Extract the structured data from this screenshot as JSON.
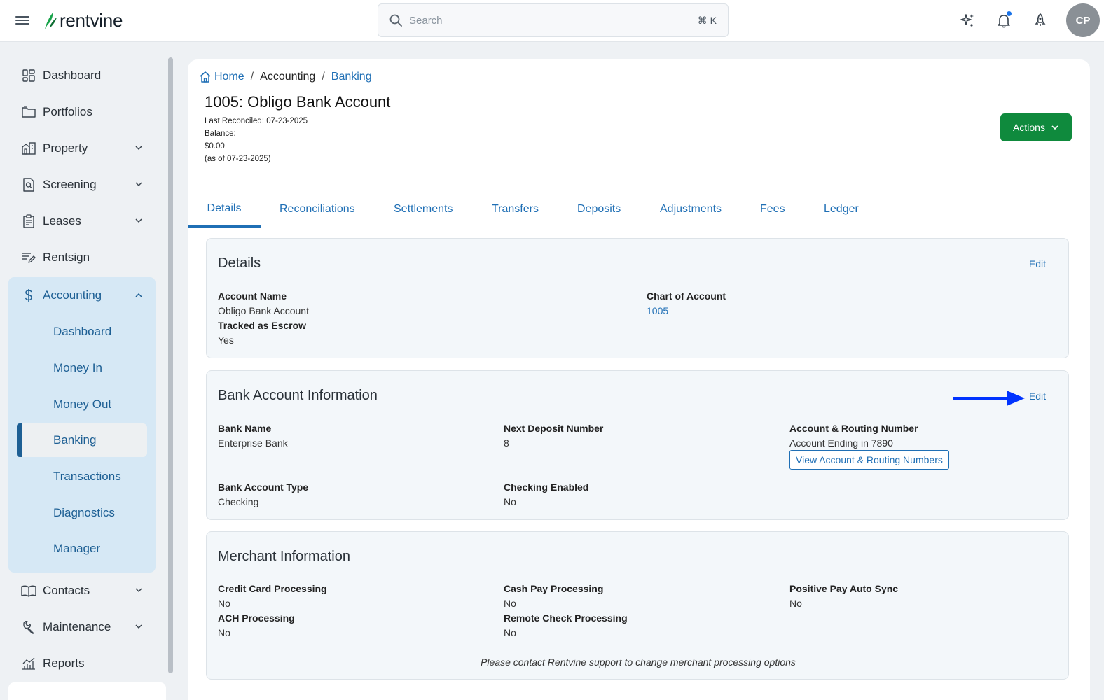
{
  "app": {
    "brand": "rentvine"
  },
  "search": {
    "placeholder": "Search",
    "shortcut": "⌘ K"
  },
  "user": {
    "initials": "CP"
  },
  "colors": {
    "brand_green": "#0f8a3d",
    "link_blue": "#1f6fb5",
    "accounting_bg": "#d6e8f5",
    "arrow_blue": "#0033ff"
  },
  "sidebar": {
    "items_top": [
      {
        "label": "Dashboard",
        "icon": "dashboard-icon"
      },
      {
        "label": "Portfolios",
        "icon": "folder-icon"
      },
      {
        "label": "Property",
        "icon": "building-icon"
      },
      {
        "label": "Screening",
        "icon": "screening-icon"
      },
      {
        "label": "Leases",
        "icon": "clipboard-icon"
      },
      {
        "label": "Rentsign",
        "icon": "sign-icon"
      }
    ],
    "accounting": {
      "label": "Accounting",
      "icon": "dollar-icon",
      "sub": [
        "Dashboard",
        "Money In",
        "Money Out",
        "Banking",
        "Transactions",
        "Diagnostics",
        "Manager"
      ],
      "active": "Banking"
    },
    "items_bottom": [
      {
        "label": "Contacts",
        "icon": "book-icon"
      },
      {
        "label": "Maintenance",
        "icon": "wrench-icon"
      },
      {
        "label": "Reports",
        "icon": "chart-icon"
      }
    ]
  },
  "breadcrumb": {
    "home": "Home",
    "section": "Accounting",
    "current": "Banking"
  },
  "page": {
    "title": "1005: Obligo Bank Account",
    "last_reconciled": "Last Reconciled: 07-23-2025",
    "balance_label": "Balance:",
    "balance_value": "$0.00",
    "balance_asof": "(as of 07-23-2025)",
    "actions_label": "Actions"
  },
  "tabs": [
    "Details",
    "Reconciliations",
    "Settlements",
    "Transfers",
    "Deposits",
    "Adjustments",
    "Fees",
    "Ledger"
  ],
  "details": {
    "title": "Details",
    "edit": "Edit",
    "account_name_label": "Account Name",
    "account_name": "Obligo Bank Account",
    "escrow_label": "Tracked as Escrow",
    "escrow": "Yes",
    "chart_label": "Chart of Account",
    "chart": "1005"
  },
  "bank": {
    "title": "Bank Account Information",
    "edit": "Edit",
    "bank_name_label": "Bank Name",
    "bank_name": "Enterprise Bank",
    "next_deposit_label": "Next Deposit Number",
    "next_deposit": "8",
    "routing_label": "Account & Routing Number",
    "routing": "Account Ending in 7890",
    "view_button": "View Account & Routing Numbers",
    "type_label": "Bank Account Type",
    "type": "Checking",
    "checking_label": "Checking Enabled",
    "checking": "No"
  },
  "merchant": {
    "title": "Merchant Information",
    "cc_label": "Credit Card Processing",
    "cc": "No",
    "ach_label": "ACH Processing",
    "ach": "No",
    "cash_label": "Cash Pay Processing",
    "cash": "No",
    "remote_label": "Remote Check Processing",
    "remote": "No",
    "positive_label": "Positive Pay Auto Sync",
    "positive": "No",
    "note": "Please contact Rentvine support to change merchant processing options"
  }
}
